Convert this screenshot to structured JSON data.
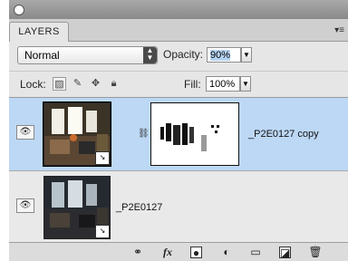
{
  "panel": {
    "tab_label": "LAYERS",
    "menu_icon": "panel-menu-icon"
  },
  "blend_mode": {
    "label": "Normal",
    "options_visible": [
      "Normal"
    ]
  },
  "opacity": {
    "label": "Opacity:",
    "value": "90%"
  },
  "lock": {
    "label": "Lock:",
    "icons": [
      "lock-transparent-icon",
      "lock-paint-icon",
      "lock-move-icon",
      "lock-all-icon"
    ]
  },
  "fill": {
    "label": "Fill:",
    "value": "100%"
  },
  "layers": [
    {
      "name": "_P2E0127 copy",
      "selected": true,
      "visible": true,
      "has_mask": true
    },
    {
      "name": "_P2E0127",
      "selected": false,
      "visible": true,
      "has_mask": false
    }
  ],
  "bottom_icons": [
    "link-layers-icon",
    "fx-icon",
    "add-mask-icon",
    "adjustment-layer-icon",
    "new-group-icon",
    "new-layer-icon",
    "trash-icon"
  ],
  "bottom_fx_label": "fx",
  "colors": {
    "selected_row": "#bcd8f5",
    "panel_bg": "#e6e6e6"
  }
}
